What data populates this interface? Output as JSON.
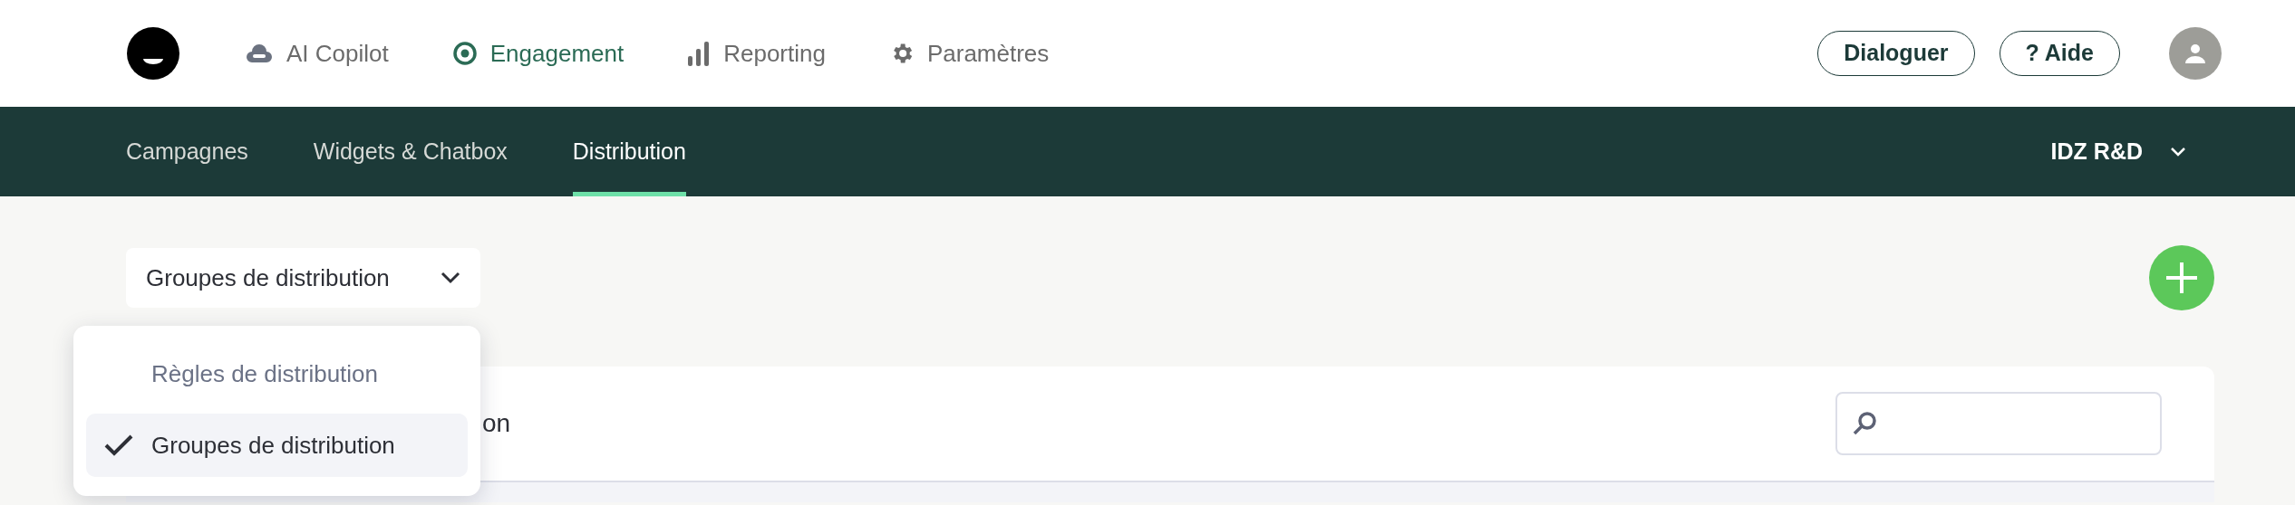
{
  "top_nav": {
    "items": [
      {
        "label": "AI Copilot",
        "kind": "cloud",
        "selected": false
      },
      {
        "label": "Engagement",
        "kind": "target",
        "selected": true
      },
      {
        "label": "Reporting",
        "kind": "bars",
        "selected": false
      },
      {
        "label": "Paramètres",
        "kind": "gear",
        "selected": false
      }
    ],
    "buttons": [
      "Dialoguer",
      "? Aide"
    ]
  },
  "sub_nav": {
    "tabs": [
      {
        "label": "Campagnes",
        "selected": false
      },
      {
        "label": "Widgets & Chatbox",
        "selected": false
      },
      {
        "label": "Distribution",
        "selected": true
      }
    ],
    "account": "IDZ R&D"
  },
  "view_select": {
    "value": "Groupes de distribution",
    "expanded": true,
    "options": [
      {
        "label": "Règles de distribution",
        "selected": false
      },
      {
        "label": "Groupes de distribution",
        "selected": true
      }
    ]
  },
  "card": {
    "title": "on"
  }
}
